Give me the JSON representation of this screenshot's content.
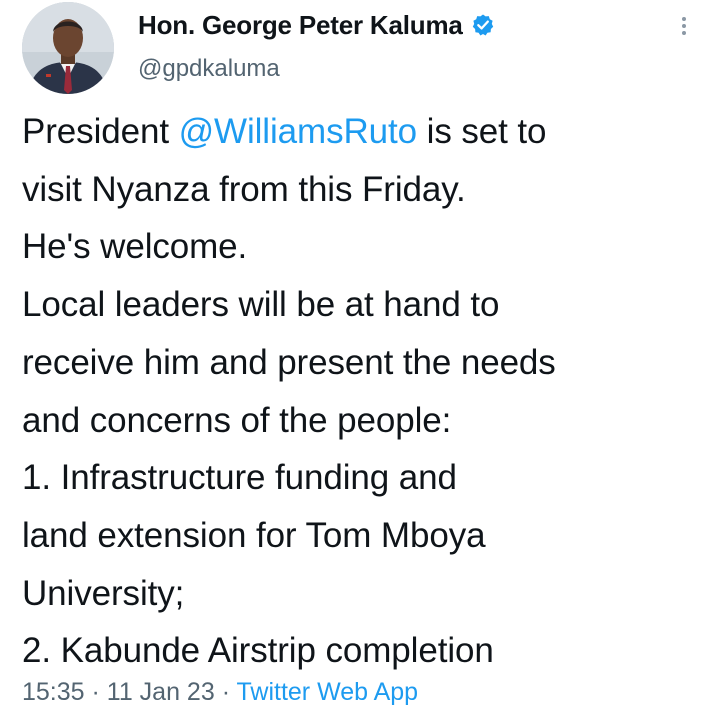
{
  "author": {
    "display_name": "Hon. George Peter Kaluma",
    "handle": "@gpdkaluma",
    "verified_icon": "verified-badge-icon",
    "avatar_icon": "profile-photo"
  },
  "menu": {
    "icon": "more-options-icon"
  },
  "tweet": {
    "lines": [
      {
        "before": "President ",
        "mention": "@WilliamsRuto",
        "after": " is set to"
      },
      {
        "text": "visit Nyanza from this Friday."
      },
      {
        "text": "He's welcome."
      },
      {
        "text": "Local leaders will be at hand to"
      },
      {
        "text": "receive him and present the needs"
      },
      {
        "text": "and concerns of the people:"
      },
      {
        "text": "1. Infrastructure funding and"
      },
      {
        "text": "land extension for Tom Mboya"
      },
      {
        "text": "University;"
      },
      {
        "text": "2. Kabunde Airstrip completion"
      }
    ]
  },
  "meta": {
    "time": "15:35",
    "separator": " · ",
    "date": "11 Jan 23",
    "source": "Twitter Web App"
  },
  "colors": {
    "accent": "#1d9bf0",
    "text": "#0f1419",
    "secondary": "#536471"
  }
}
